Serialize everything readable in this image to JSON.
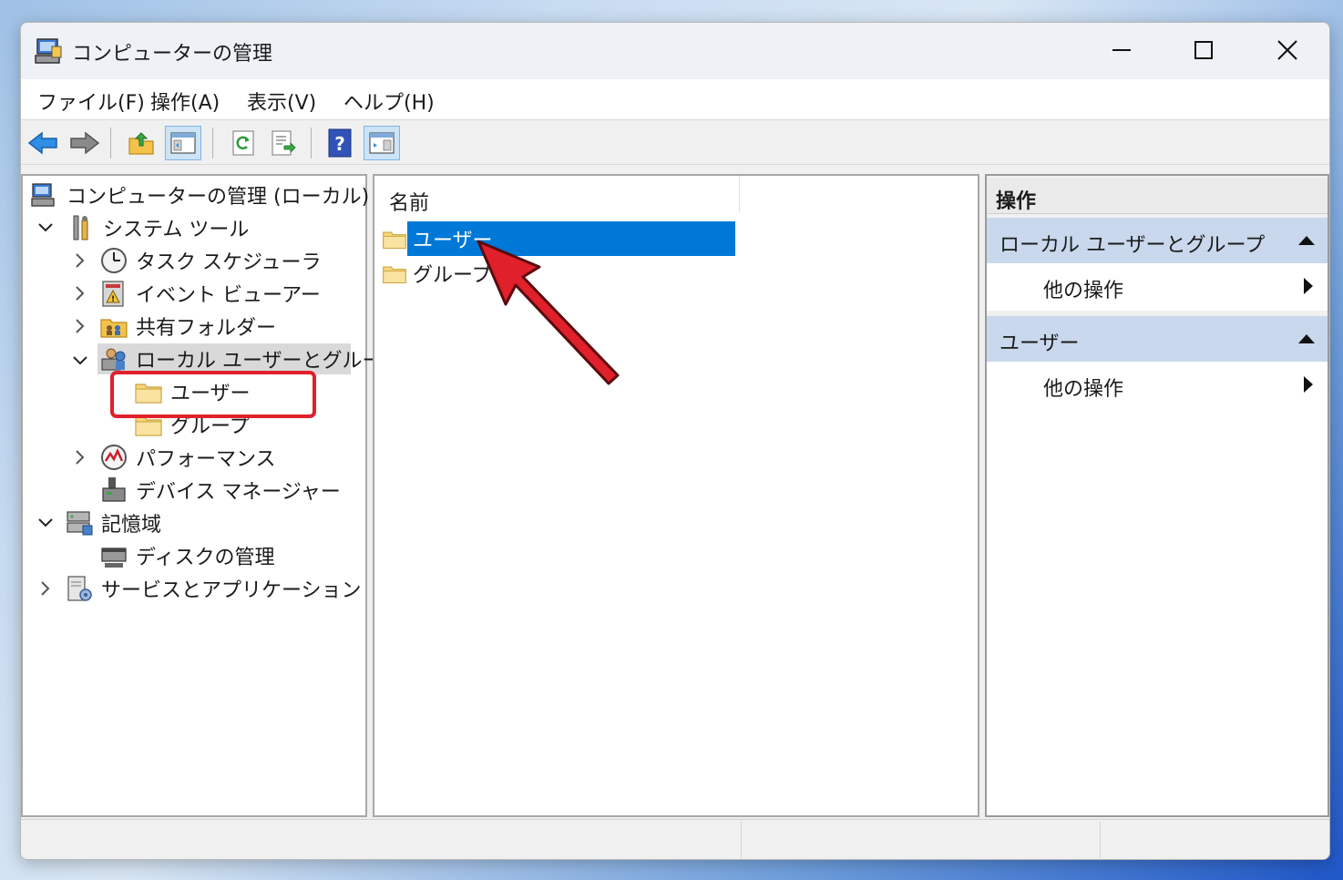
{
  "window": {
    "title": "コンピューターの管理"
  },
  "menu": [
    "ファイル(F)",
    "操作(A)",
    "表示(V)",
    "ヘルプ(H)"
  ],
  "tree": {
    "root": "コンピューターの管理 (ローカル)",
    "system_tools": "システム ツール",
    "task_scheduler": "タスク スケジューラ",
    "event_viewer": "イベント ビューアー",
    "shared_folders": "共有フォルダー",
    "local_users_groups": "ローカル ユーザーとグループ",
    "users": "ユーザー",
    "groups": "グループ",
    "performance": "パフォーマンス",
    "device_manager": "デバイス マネージャー",
    "storage": "記憶域",
    "disk_management": "ディスクの管理",
    "services_apps": "サービスとアプリケーション"
  },
  "list": {
    "column_name": "名前",
    "items": [
      "ユーザー",
      "グループ"
    ],
    "selected_index": 0
  },
  "actions": {
    "header": "操作",
    "sections": [
      {
        "title": "ローカル ユーザーとグループ",
        "item": "他の操作"
      },
      {
        "title": "ユーザー",
        "item": "他の操作"
      }
    ]
  },
  "colors": {
    "selection": "#0078d7",
    "highlight_box": "#e0202a",
    "arrow": "#e0202a"
  }
}
